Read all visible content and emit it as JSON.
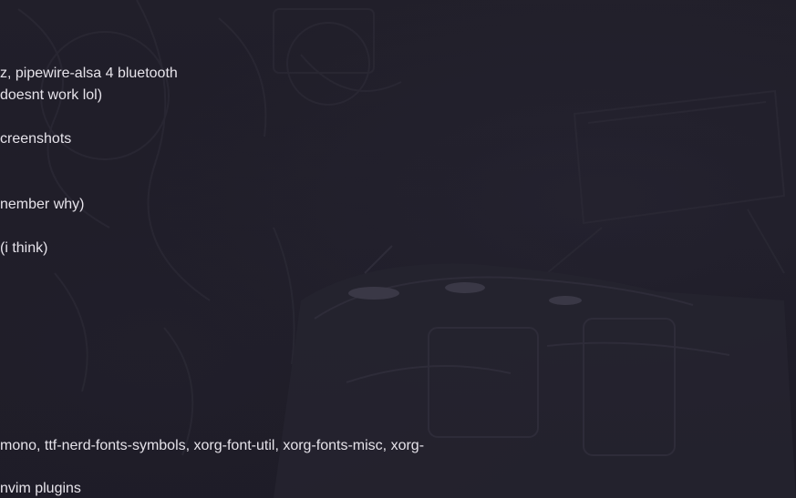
{
  "text_lines": [
    "z, pipewire-alsa 4 bluetooth",
    "doesnt work lol)",
    "creenshots",
    "nember why)",
    "(i think)",
    "mono, ttf-nerd-fonts-symbols, xorg-font-util, xorg-fonts-misc, xorg-",
    "nvim plugins"
  ],
  "colors": {
    "background": "#1f1d28",
    "text": "#e6e3ea"
  }
}
